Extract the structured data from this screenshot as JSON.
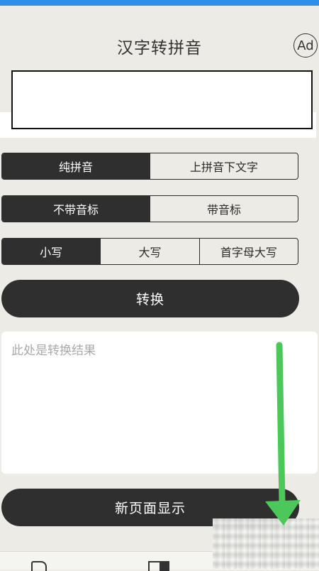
{
  "header": {
    "title": "汉字转拼音",
    "ad_label": "Ad"
  },
  "input": {
    "value": "",
    "placeholder": ""
  },
  "mode_pinyin": {
    "options": [
      "纯拼音",
      "上拼音下文字"
    ],
    "selected": "纯拼音"
  },
  "mode_tone": {
    "options": [
      "不带音标",
      "带音标"
    ],
    "selected": "不带音标"
  },
  "mode_case": {
    "options": [
      "小写",
      "大写",
      "首字母大写"
    ],
    "selected": "小写"
  },
  "actions": {
    "convert_label": "转换",
    "new_page_label": "新页面显示"
  },
  "result": {
    "placeholder": "此处是转换结果"
  },
  "colors": {
    "background": "#ecebe6",
    "dark": "#2f2f2f",
    "status_strip": "#2f8fe6",
    "annotation_arrow": "#4cc85a"
  },
  "icons": {
    "bottom_tab_1": "phone-rotate-icon",
    "bottom_tab_2": "split-view-icon"
  }
}
